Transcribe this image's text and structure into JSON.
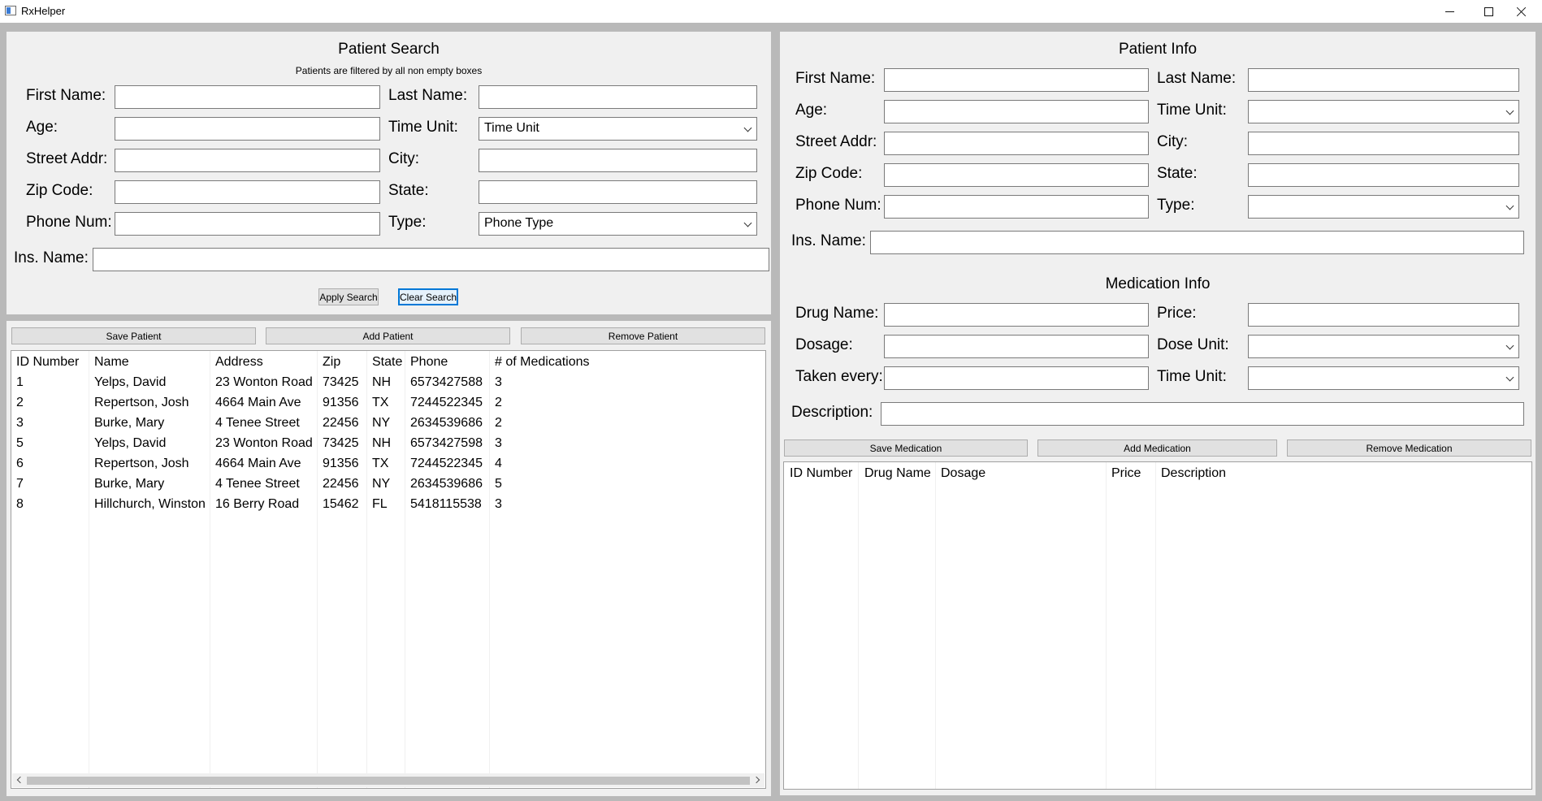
{
  "window": {
    "title": "RxHelper"
  },
  "patient_search": {
    "heading": "Patient Search",
    "subheading": "Patients are filtered by all non empty boxes",
    "labels": {
      "first_name": "First Name:",
      "last_name": "Last Name:",
      "age": "Age:",
      "time_unit": "Time Unit:",
      "street_addr": "Street Addr:",
      "city": "City:",
      "zip_code": "Zip Code:",
      "state": "State:",
      "phone_num": "Phone Num:",
      "type": "Type:",
      "ins_name": "Ins. Name:"
    },
    "time_unit_value": "Time Unit",
    "phone_type_value": "Phone Type",
    "apply_label": "Apply Search",
    "clear_label": "Clear Search"
  },
  "patient_actions": {
    "save": "Save Patient",
    "add": "Add Patient",
    "remove": "Remove Patient"
  },
  "patients_table": {
    "headers": [
      "ID Number",
      "Name",
      "Address",
      "Zip",
      "State",
      "Phone",
      "# of Medications"
    ],
    "rows": [
      [
        "1",
        "Yelps, David",
        "23 Wonton Road",
        "73425",
        "NH",
        "6573427588",
        "3"
      ],
      [
        "2",
        "Repertson, Josh",
        "4664 Main Ave",
        "91356",
        "TX",
        "7244522345",
        "2"
      ],
      [
        "3",
        "Burke, Mary",
        "4 Tenee Street",
        "22456",
        "NY",
        "2634539686",
        "2"
      ],
      [
        "5",
        "Yelps, David",
        "23 Wonton Road",
        "73425",
        "NH",
        "6573427598",
        "3"
      ],
      [
        "6",
        "Repertson, Josh",
        "4664 Main Ave",
        "91356",
        "TX",
        "7244522345",
        "4"
      ],
      [
        "7",
        "Burke, Mary",
        "4 Tenee Street",
        "22456",
        "NY",
        "2634539686",
        "5"
      ],
      [
        "8",
        "Hillchurch, Winston",
        "16 Berry Road",
        "15462",
        "FL",
        "5418115538",
        "3"
      ]
    ]
  },
  "patient_info": {
    "heading": "Patient Info",
    "labels": {
      "first_name": "First Name:",
      "last_name": "Last Name:",
      "age": "Age:",
      "time_unit": "Time Unit:",
      "street_addr": "Street Addr:",
      "city": "City:",
      "zip_code": "Zip Code:",
      "state": "State:",
      "phone_num": "Phone Num:",
      "type": "Type:",
      "ins_name": "Ins. Name:"
    }
  },
  "medication_info": {
    "heading": "Medication Info",
    "labels": {
      "drug_name": "Drug Name:",
      "price": "Price:",
      "dosage": "Dosage:",
      "dose_unit": "Dose Unit:",
      "taken_every": "Taken every:",
      "time_unit": "Time Unit:",
      "description": "Description:"
    }
  },
  "medication_actions": {
    "save": "Save Medication",
    "add": "Add Medication",
    "remove": "Remove Medication"
  },
  "medications_table": {
    "headers": [
      "ID Number",
      "Drug Name",
      "Dosage",
      "Price",
      "Description"
    ]
  }
}
